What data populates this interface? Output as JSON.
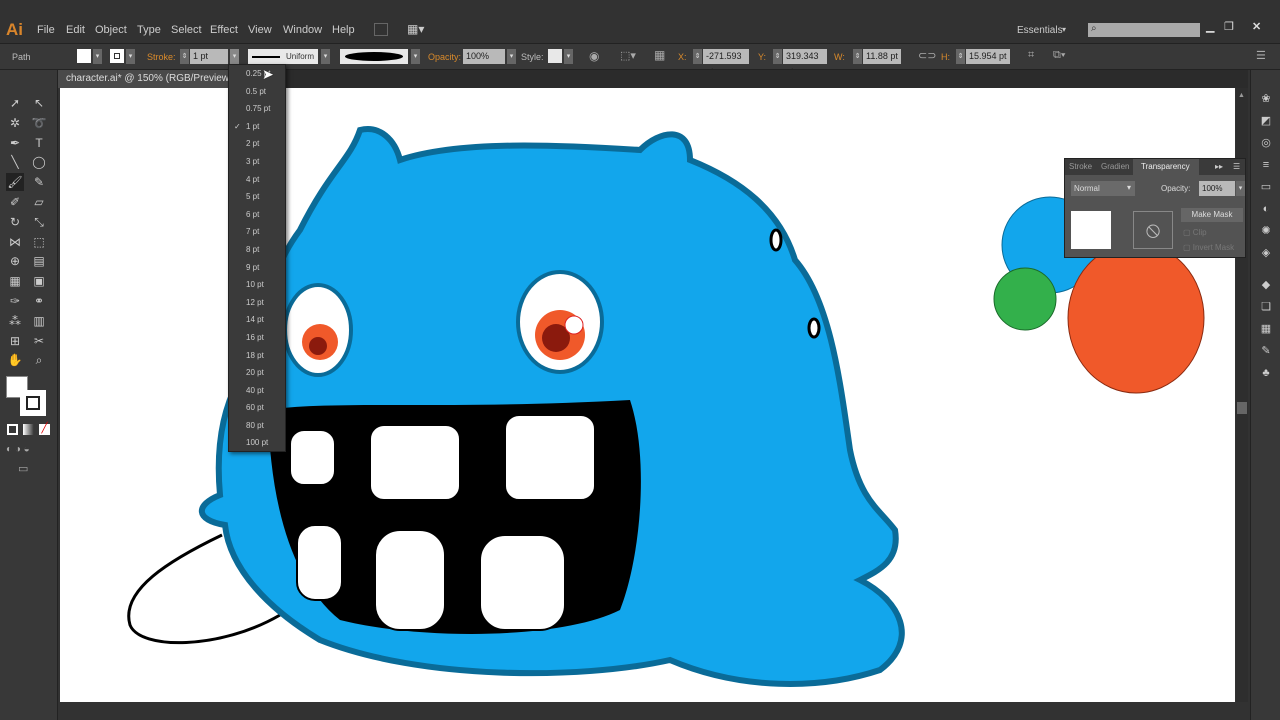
{
  "app": {
    "logo": "Ai",
    "menus": [
      "File",
      "Edit",
      "Object",
      "Type",
      "Select",
      "Effect",
      "View",
      "Window",
      "Help"
    ],
    "workspace": "Essentials",
    "search_placeholder": ""
  },
  "control": {
    "selection": "Path",
    "stroke_label": "Stroke:",
    "stroke_weight": "1 pt",
    "profile": "Uniform",
    "opacity_label": "Opacity:",
    "opacity": "100%",
    "style_label": "Style:",
    "x_label": "X:",
    "x": "-271.593 pt",
    "y_label": "Y:",
    "y": "319.343 pt",
    "w_label": "W:",
    "w": "11.88 pt",
    "h_label": "H:",
    "h": "15.954 pt"
  },
  "document": {
    "tab": "character.ai* @ 150% (RGB/Preview)"
  },
  "stroke_dropdown": {
    "selected": "1 pt",
    "options": [
      "0.25 pt",
      "0.5 pt",
      "0.75 pt",
      "1 pt",
      "2 pt",
      "3 pt",
      "4 pt",
      "5 pt",
      "6 pt",
      "7 pt",
      "8 pt",
      "9 pt",
      "10 pt",
      "12 pt",
      "14 pt",
      "16 pt",
      "18 pt",
      "20 pt",
      "40 pt",
      "60 pt",
      "80 pt",
      "100 pt"
    ]
  },
  "transparency_panel": {
    "tabs": [
      "Stroke",
      "Gradien",
      "Transparency"
    ],
    "blend_mode": "Normal",
    "opacity_label": "Opacity:",
    "opacity": "100%",
    "make_mask": "Make Mask",
    "clip": "Clip",
    "invert_mask": "Invert Mask"
  },
  "colors": {
    "monster": "#12a6ec",
    "outline": "#0a6b98",
    "orange": "#f0592a",
    "green": "#33b04b"
  }
}
